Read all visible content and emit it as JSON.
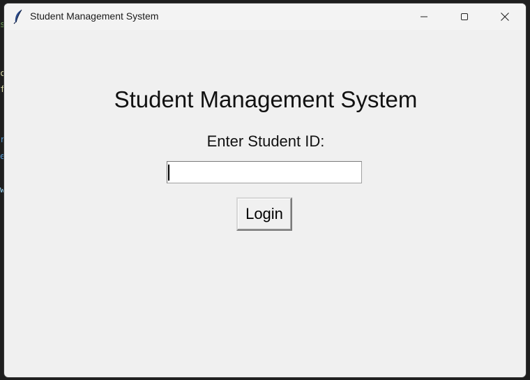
{
  "window": {
    "title": "Student Management System"
  },
  "main": {
    "heading": "Student Management System",
    "id_label": "Enter Student ID:",
    "id_value": "",
    "login_label": "Login"
  },
  "background_editor_chars": [
    {
      "char": "s",
      "color": "#6a9955"
    },
    {
      "char": "c",
      "color": "#dcdcaa"
    },
    {
      "char": "f",
      "color": "#dcdcaa"
    },
    {
      "char": "r",
      "color": "#569cd6"
    },
    {
      "char": "e",
      "color": "#569cd6"
    },
    {
      "char": "w",
      "color": "#9cdcfe"
    }
  ],
  "icons": {
    "app": "feather-icon",
    "minimize": "minimize-icon",
    "maximize": "maximize-icon",
    "close": "close-icon"
  }
}
